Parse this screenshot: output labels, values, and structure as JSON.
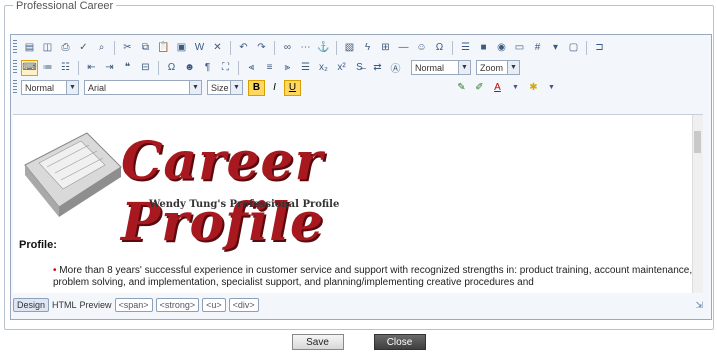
{
  "fieldset": {
    "legend": "Professional Career"
  },
  "toolbar": {
    "row1_icons": [
      "new-doc-icon",
      "preview-icon",
      "print-icon",
      "spellcheck-icon",
      "find-icon",
      "cut-icon",
      "copy-icon",
      "paste-icon",
      "paste-text-icon",
      "paste-word-icon",
      "delete-icon",
      "undo-icon",
      "redo-icon",
      "link-icon",
      "unlink-icon",
      "anchor-icon",
      "image-icon",
      "flash-icon",
      "table-icon",
      "hr-icon",
      "smiley-icon",
      "special-char-icon",
      "pagebreak-icon",
      "form-icon",
      "checkbox-icon",
      "radio-icon",
      "textfield-icon",
      "textarea-icon",
      "select-icon",
      "button-icon",
      "imagebutton-icon",
      "hidden-field-icon"
    ],
    "row2_icons": [
      "source-icon",
      "bold-split-icon",
      "italic-split-icon",
      "numbered-list-icon",
      "bulleted-list-icon",
      "outdent-icon",
      "indent-icon",
      "blockquote-icon",
      "align-left-icon",
      "align-center-icon",
      "align-right-icon",
      "justify-icon",
      "subscript-icon",
      "superscript-icon",
      "remove-format-icon",
      "template-icon",
      "maximize-icon"
    ],
    "font_size_label": "Normal",
    "font_name": "Arial",
    "size_label": "Size",
    "bold_label": "B",
    "italic_label": "I",
    "underline_label": "U",
    "styles_dropdown": "Normal",
    "zoom_dropdown": "Zoom"
  },
  "content": {
    "banner_title": "Career Profile",
    "banner_subtitle": "Wendy Tung's Professional Profile",
    "section_label": "Profile:",
    "bullet_text": "More than 8 years' successful experience in customer service and support with recognized strengths in: product training, account maintenance, problem solving, and implementation, specialist support, and planning/implementing creative procedures and"
  },
  "status_bar": {
    "mode_label": "Design",
    "mode_secondary": "HTML",
    "path_label": "Preview",
    "tags": [
      "<span>",
      "<strong>",
      "<u>",
      "<div>"
    ]
  },
  "buttons": {
    "save": "Save",
    "close": "Close"
  }
}
